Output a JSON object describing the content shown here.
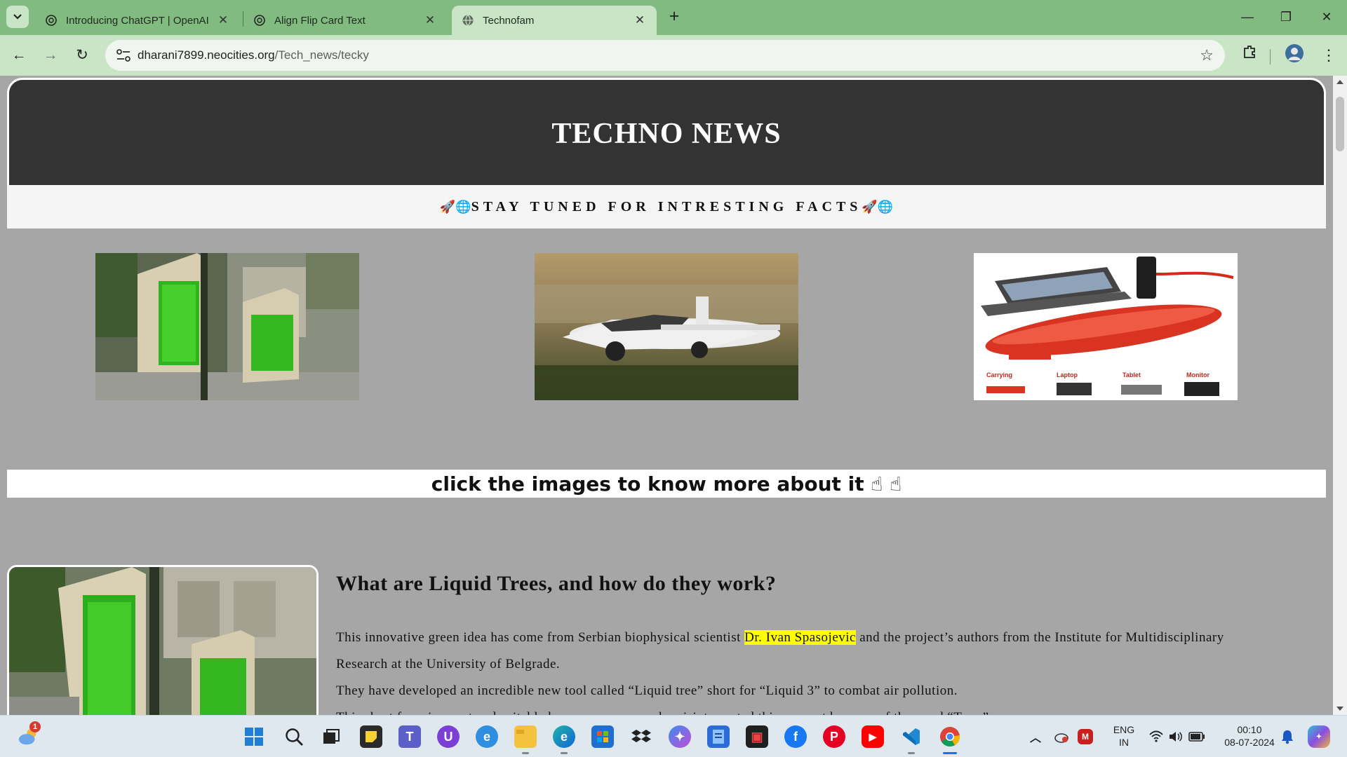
{
  "browser": {
    "tabs": [
      {
        "title": "Introducing ChatGPT | OpenAI",
        "close": "✕"
      },
      {
        "title": "Align Flip Card Text",
        "close": "✕"
      },
      {
        "title": "Technofam",
        "close": "✕"
      }
    ],
    "new_tab": "+",
    "window_controls": {
      "minimize": "—",
      "restore": "❐",
      "close": "✕"
    },
    "url_host": "dharani7899.neocities.org",
    "url_path": "/Tech_news/tecky",
    "nav": {
      "back": "←",
      "forward": "→",
      "reload": "↻"
    },
    "bookmark_star": "☆",
    "menu_dots": "⋮",
    "accent": "#82bb80"
  },
  "page": {
    "header_title": "TECHNO NEWS",
    "tagline_emoji_left": "🚀🌐",
    "tagline": "STAY TUNED FOR INTRESTING FACTS",
    "tagline_emoji_right": "🚀🌐",
    "thumbnails": [
      {
        "name": "liquid-tree-image"
      },
      {
        "name": "flying-car-image"
      },
      {
        "name": "portable-computer-image"
      }
    ],
    "cta_text": "click the images to know more about it",
    "cta_emoji": "☝ ☝",
    "article": {
      "title": "What are Liquid Trees, and how do they work?",
      "p1_before": "This innovative green idea has come from Serbian biophysical scientist ",
      "p1_highlight": "Dr. Ivan Spasojevic",
      "p1_after": " and the project’s authors from the Institute for Multidisciplinary Research at the University of Belgrade.",
      "p2": "They have developed an incredible new tool called “Liquid tree” short for “Liquid 3” to combat air pollution.",
      "p3": "This short form is smart and suitable because many people misinterpreted this concept because of the word “Tree.”"
    },
    "image_labels": {
      "carrying": "Carrying",
      "laptop": "Laptop",
      "tablet": "Tablet",
      "monitor": "Monitor"
    }
  },
  "taskbar": {
    "weather_badge": "1",
    "language": "ENG",
    "region": "IN",
    "time": "00:10",
    "date": "08-07-2024"
  }
}
